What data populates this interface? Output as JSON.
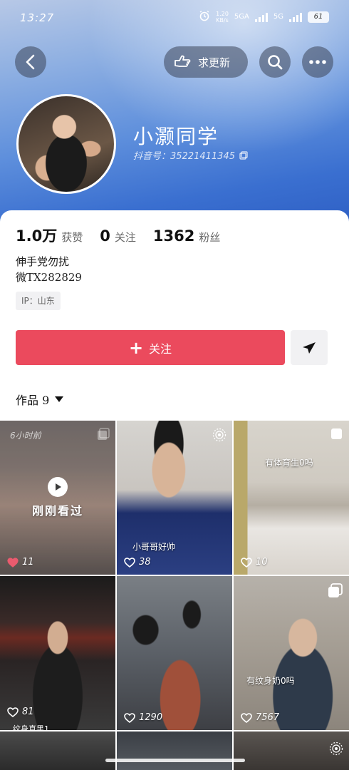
{
  "status_bar": {
    "time": "13:27",
    "speed_value": "1.20",
    "speed_unit": "KB/s",
    "net1": "5GA",
    "net2": "5G",
    "battery": "61"
  },
  "top_actions": {
    "update_label": "求更新"
  },
  "profile": {
    "name": "小灏同学",
    "douyin_id": "抖音号：35221411345"
  },
  "stats": [
    {
      "value": "1.0万",
      "label": "获赞"
    },
    {
      "value": "0",
      "label": "关注"
    },
    {
      "value": "1362",
      "label": "粉丝"
    }
  ],
  "bio": {
    "line1": "伸手党勿扰",
    "line2": "微TX282829"
  },
  "ip_location": "IP：山东",
  "follow_label": "关注",
  "works_tab": "作品 9",
  "tiles": [
    {
      "time_ago": "6小时前",
      "watched": "刚刚看过",
      "likes": "11"
    },
    {
      "caption": "小哥哥好帅",
      "likes": "38"
    },
    {
      "caption": "有体育生0吗",
      "likes": "10"
    },
    {
      "caption": "纹身真黑1",
      "likes": "81"
    },
    {
      "caption": "",
      "likes": "1290"
    },
    {
      "caption": "有纹身奶0吗",
      "likes": "7567"
    }
  ],
  "colors": {
    "follow_button": "#eb4a5d",
    "header_gradient_end": "#2e5fc4"
  }
}
